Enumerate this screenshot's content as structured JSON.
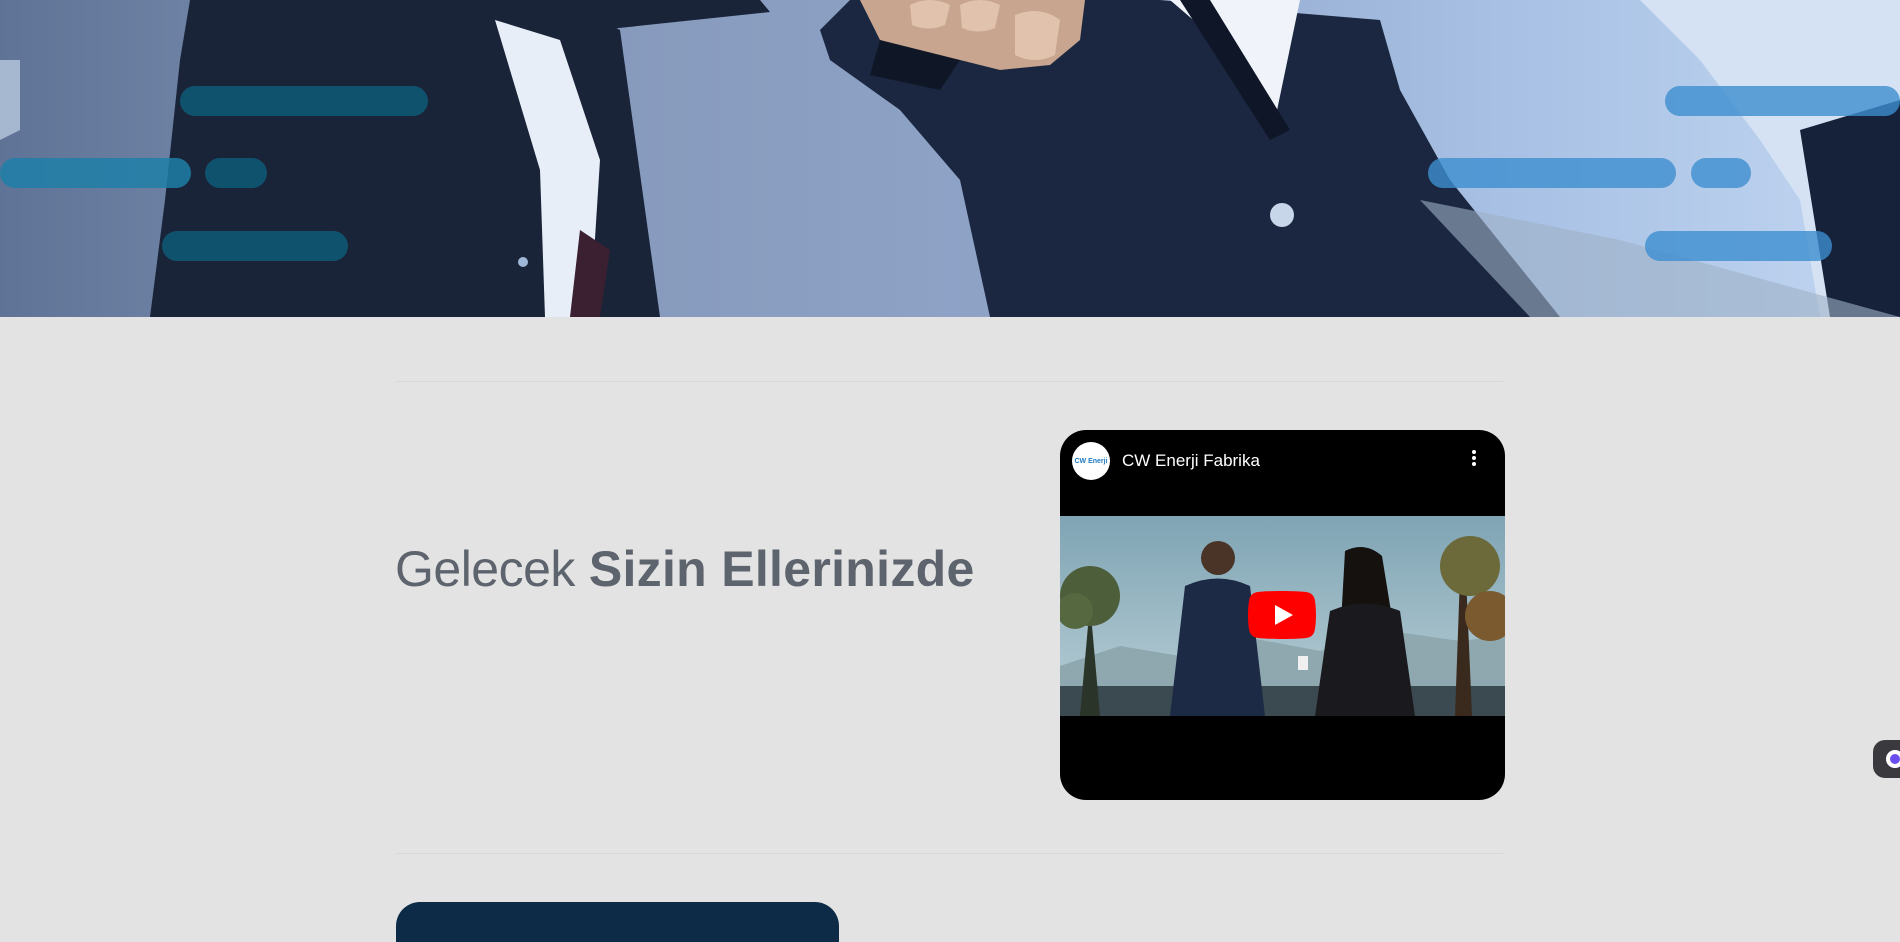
{
  "hero": {
    "image": "business-fist-bump-photo",
    "accent_colors": [
      "#0e5a78",
      "#2b8bbd",
      "#5aa9e3"
    ]
  },
  "section": {
    "headline_light": "Gelecek",
    "headline_bold": "Sizin Ellerinizde",
    "headline_color": "#5d646d"
  },
  "video": {
    "channel_name": "CW Enerji Fabrika",
    "avatar_text": "CW Enerji",
    "menu_icon": "more-vert-icon",
    "play_icon": "youtube-play-icon",
    "play_color": "#ff0000"
  },
  "widget": {
    "icon": "chat-assistant-icon"
  }
}
